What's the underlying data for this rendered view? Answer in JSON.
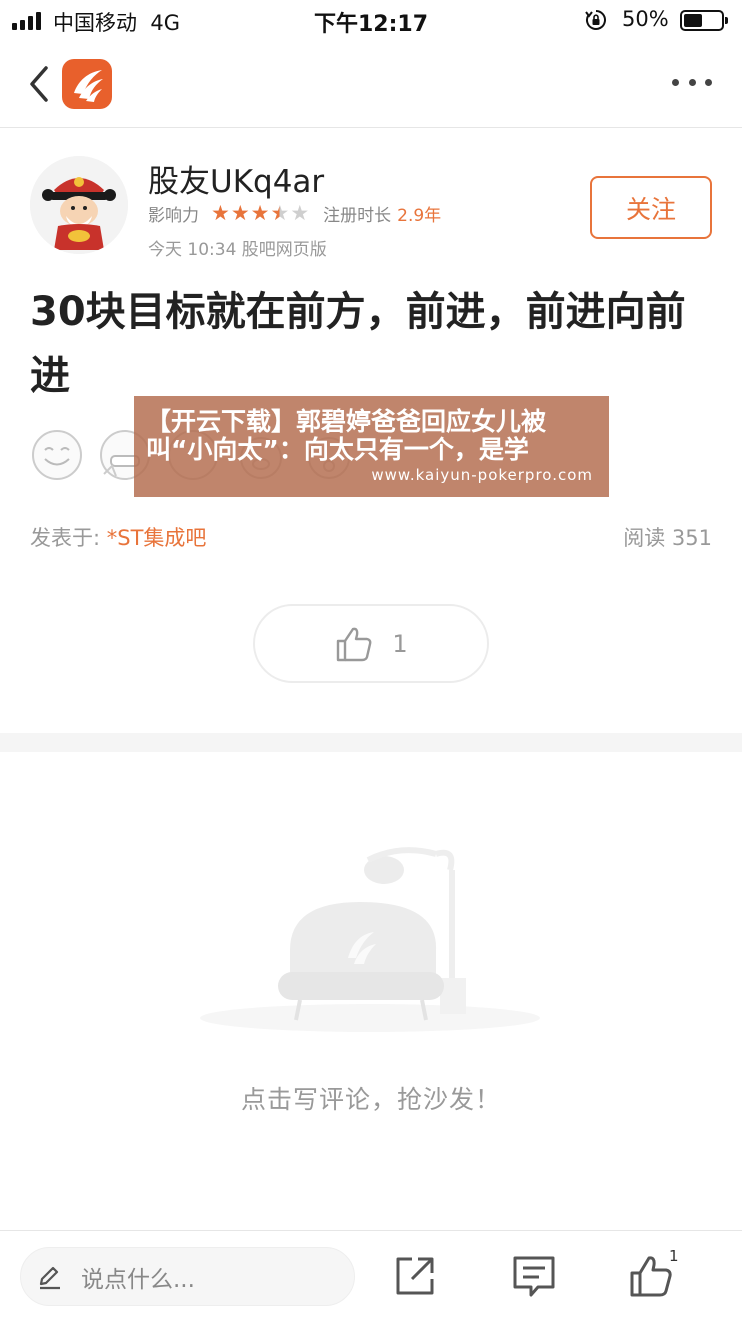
{
  "status_bar": {
    "carrier": "中国移动",
    "network": "4G",
    "time": "下午12:17",
    "battery_percent": "50%",
    "battery_level": 0.5
  },
  "nav": {
    "back_icon": "chevron-left-icon",
    "logo_icon": "guba-logo-icon",
    "more_icon": "more-dots-icon"
  },
  "author": {
    "name": "股友UKq4ar",
    "influence_label": "影响力",
    "influence_stars": 3.5,
    "influence_max": 5,
    "registration_label": "注册时长",
    "registration_value": "2.9年",
    "post_meta": "今天 10:34 股吧网页版",
    "follow_label": "关注"
  },
  "post": {
    "title": "30块目标就在前方，前进，前进向前进",
    "emojis": [
      "smile-emoji-icon",
      "grin-emoji-icon",
      "laugh-emoji-icon",
      "pig-emoji-icon",
      "sweat-emoji-icon"
    ],
    "posted_in_label": "发表于: ",
    "bar_name": "*ST集成吧",
    "read_label": "阅读 351",
    "like_count": "1"
  },
  "watermark": {
    "headline": "【开云下载】郭碧婷爸爸回应女儿被叫“小向太”：向太只有一个，是学",
    "url": "www.kaiyun-pokerpro.com"
  },
  "comments": {
    "empty_text": "点击写评论，抢沙发！"
  },
  "bottom_bar": {
    "input_placeholder": "说点什么...",
    "like_count": "1"
  },
  "colors": {
    "accent": "#e8743b",
    "logo": "#e8602c",
    "muted_text": "#999999"
  }
}
